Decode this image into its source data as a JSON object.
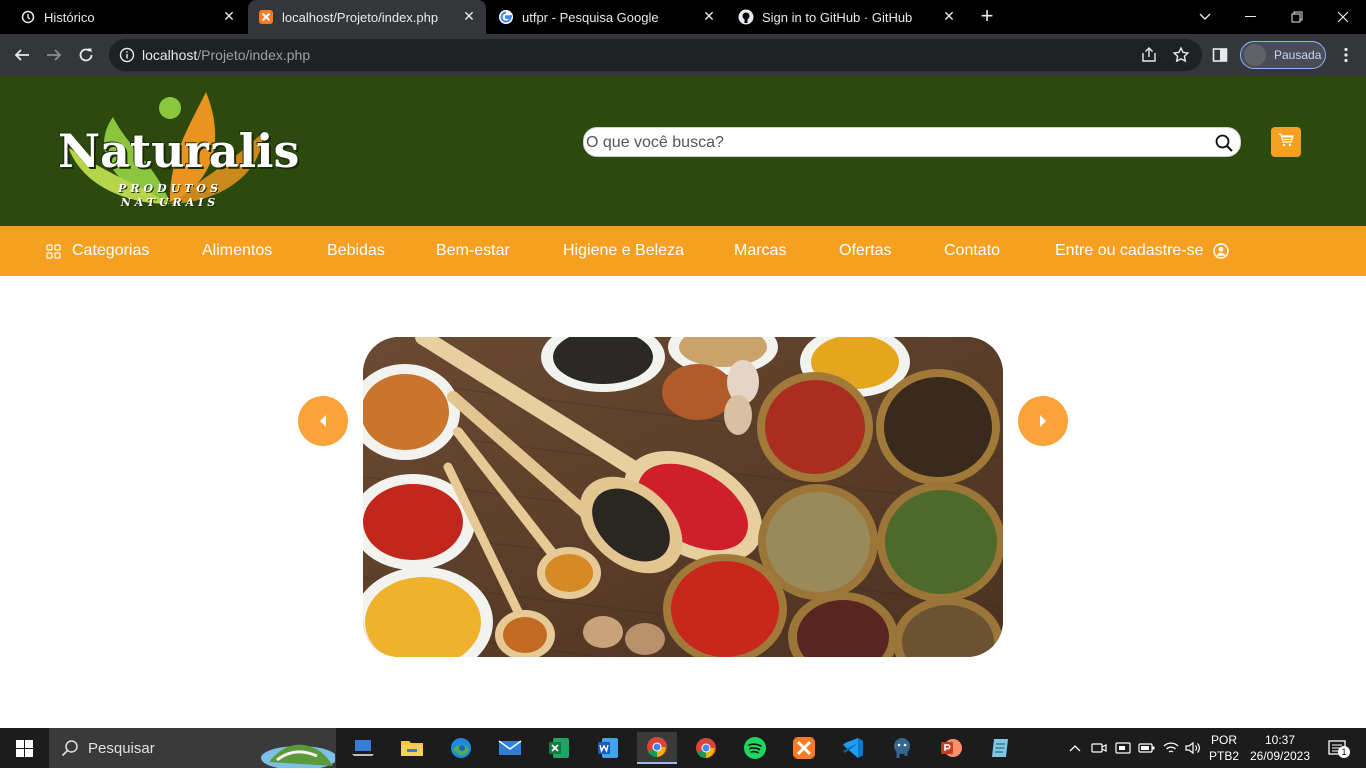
{
  "browser": {
    "tabs": [
      {
        "title": "Histórico",
        "icon": "history-icon",
        "active": false
      },
      {
        "title": "localhost/Projeto/index.php",
        "icon": "xampp-icon",
        "active": true
      },
      {
        "title": "utfpr - Pesquisa Google",
        "icon": "google-icon",
        "active": false
      },
      {
        "title": "Sign in to GitHub · GitHub",
        "icon": "github-icon",
        "active": false
      }
    ],
    "url_host": "localhost",
    "url_path": "/Projeto/index.php",
    "profile_label": "Pausada"
  },
  "site": {
    "logo": {
      "name": "Naturalis",
      "sub1": "PRODUTOS",
      "sub2": "NATURAIS"
    },
    "search_placeholder": "O que você busca?",
    "nav": [
      {
        "label": "Categorias",
        "icon": "grid-icon"
      },
      {
        "label": "Alimentos"
      },
      {
        "label": "Bebidas"
      },
      {
        "label": "Bem-estar"
      },
      {
        "label": "Higiene e Beleza"
      },
      {
        "label": "Marcas"
      },
      {
        "label": "Ofertas"
      },
      {
        "label": "Contato"
      },
      {
        "label": "Entre ou cadastre-se",
        "icon": "user-icon"
      }
    ],
    "carousel": {
      "image": "spices-bowls-and-spoons",
      "prev_icon": "caret-left-icon",
      "next_icon": "caret-right-icon"
    },
    "colors": {
      "header_green": "#2d4a0e",
      "accent_orange": "#f5a021"
    }
  },
  "taskbar": {
    "search_label": "Pesquisar",
    "apps": [
      "laptop-icon",
      "file-explorer-icon",
      "edge-icon",
      "mail-icon",
      "excel-icon",
      "word-icon",
      "chrome-icon",
      "chrome-icon",
      "spotify-icon",
      "xampp-icon",
      "vscode-icon",
      "postgresql-icon",
      "powerpoint-icon",
      "notes-icon"
    ],
    "lang_line1": "POR",
    "lang_line2": "PTB2",
    "time": "10:37",
    "date": "26/09/2023",
    "notification_count": "1"
  }
}
